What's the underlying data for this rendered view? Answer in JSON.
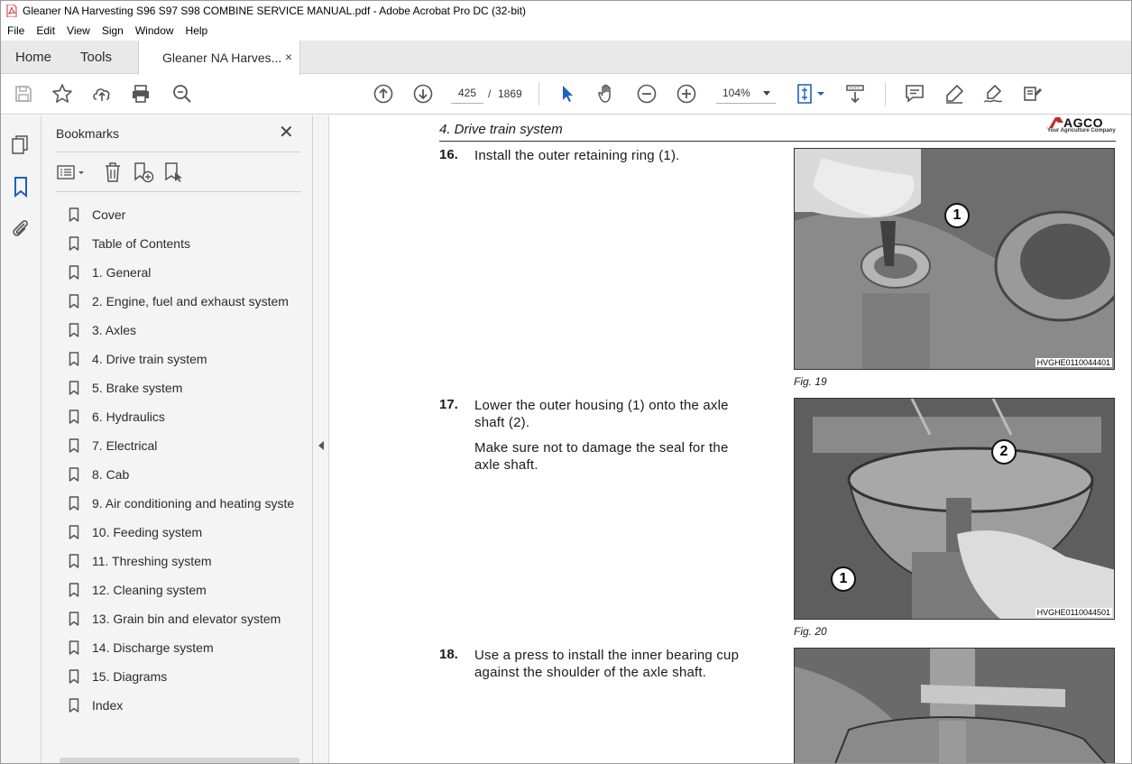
{
  "window": {
    "title": "Gleaner NA Harvesting S96  S97  S98 COMBINE SERVICE MANUAL.pdf - Adobe Acrobat Pro DC (32-bit)",
    "accent_color": "#d32f2f"
  },
  "menu": [
    "File",
    "Edit",
    "View",
    "Sign",
    "Window",
    "Help"
  ],
  "tabs": {
    "home": "Home",
    "tools": "Tools",
    "document": "Gleaner NA Harves...",
    "close_glyph": "×"
  },
  "toolbar": {
    "current_page": "425",
    "page_separator": "/",
    "total_pages": "1869",
    "zoom": "104%",
    "icons": [
      "save-icon",
      "bookmark-star-icon",
      "upload-cloud-icon",
      "print-icon",
      "search-zoom-icon",
      "page-up-icon",
      "page-down-icon",
      "select-cursor-icon",
      "hand-tool-icon",
      "zoom-out-icon",
      "zoom-in-icon",
      "fit-page-icon",
      "scroll-mode-icon",
      "comment-icon",
      "highlight-icon",
      "sign-icon",
      "redact-icon"
    ]
  },
  "bookmarks_panel": {
    "title": "Bookmarks",
    "close_glyph": "✕",
    "items": [
      "Cover",
      "Table of Contents",
      "1. General",
      "2. Engine, fuel and exhaust system",
      "3. Axles",
      "4. Drive train system",
      "5. Brake system",
      "6. Hydraulics",
      "7. Electrical",
      "8. Cab",
      "9. Air conditioning and heating syste",
      "10. Feeding system",
      "11. Threshing system",
      "12. Cleaning system",
      "13. Grain bin and elevator system",
      "14. Discharge system",
      "15. Diagrams",
      "Index"
    ]
  },
  "document": {
    "section_header": "4. Drive train system",
    "logo_text": "AGCO",
    "logo_tagline": "Your Agriculture Company",
    "steps": [
      {
        "number": "16.",
        "paragraphs": [
          "Install the outer retaining ring (1)."
        ],
        "figure_caption": "Fig. 19",
        "figure_code": "HVGHE0110044401",
        "callouts": [
          "1"
        ]
      },
      {
        "number": "17.",
        "paragraphs": [
          "Lower the outer housing (1) onto the axle shaft (2).",
          "Make sure not to damage the seal for the axle shaft."
        ],
        "figure_caption": "Fig. 20",
        "figure_code": "HVGHE0110044501",
        "callouts": [
          "2",
          "1"
        ]
      },
      {
        "number": "18.",
        "paragraphs": [
          "Use a press to install the inner bearing cup against the shoulder of the axle shaft."
        ]
      }
    ]
  }
}
